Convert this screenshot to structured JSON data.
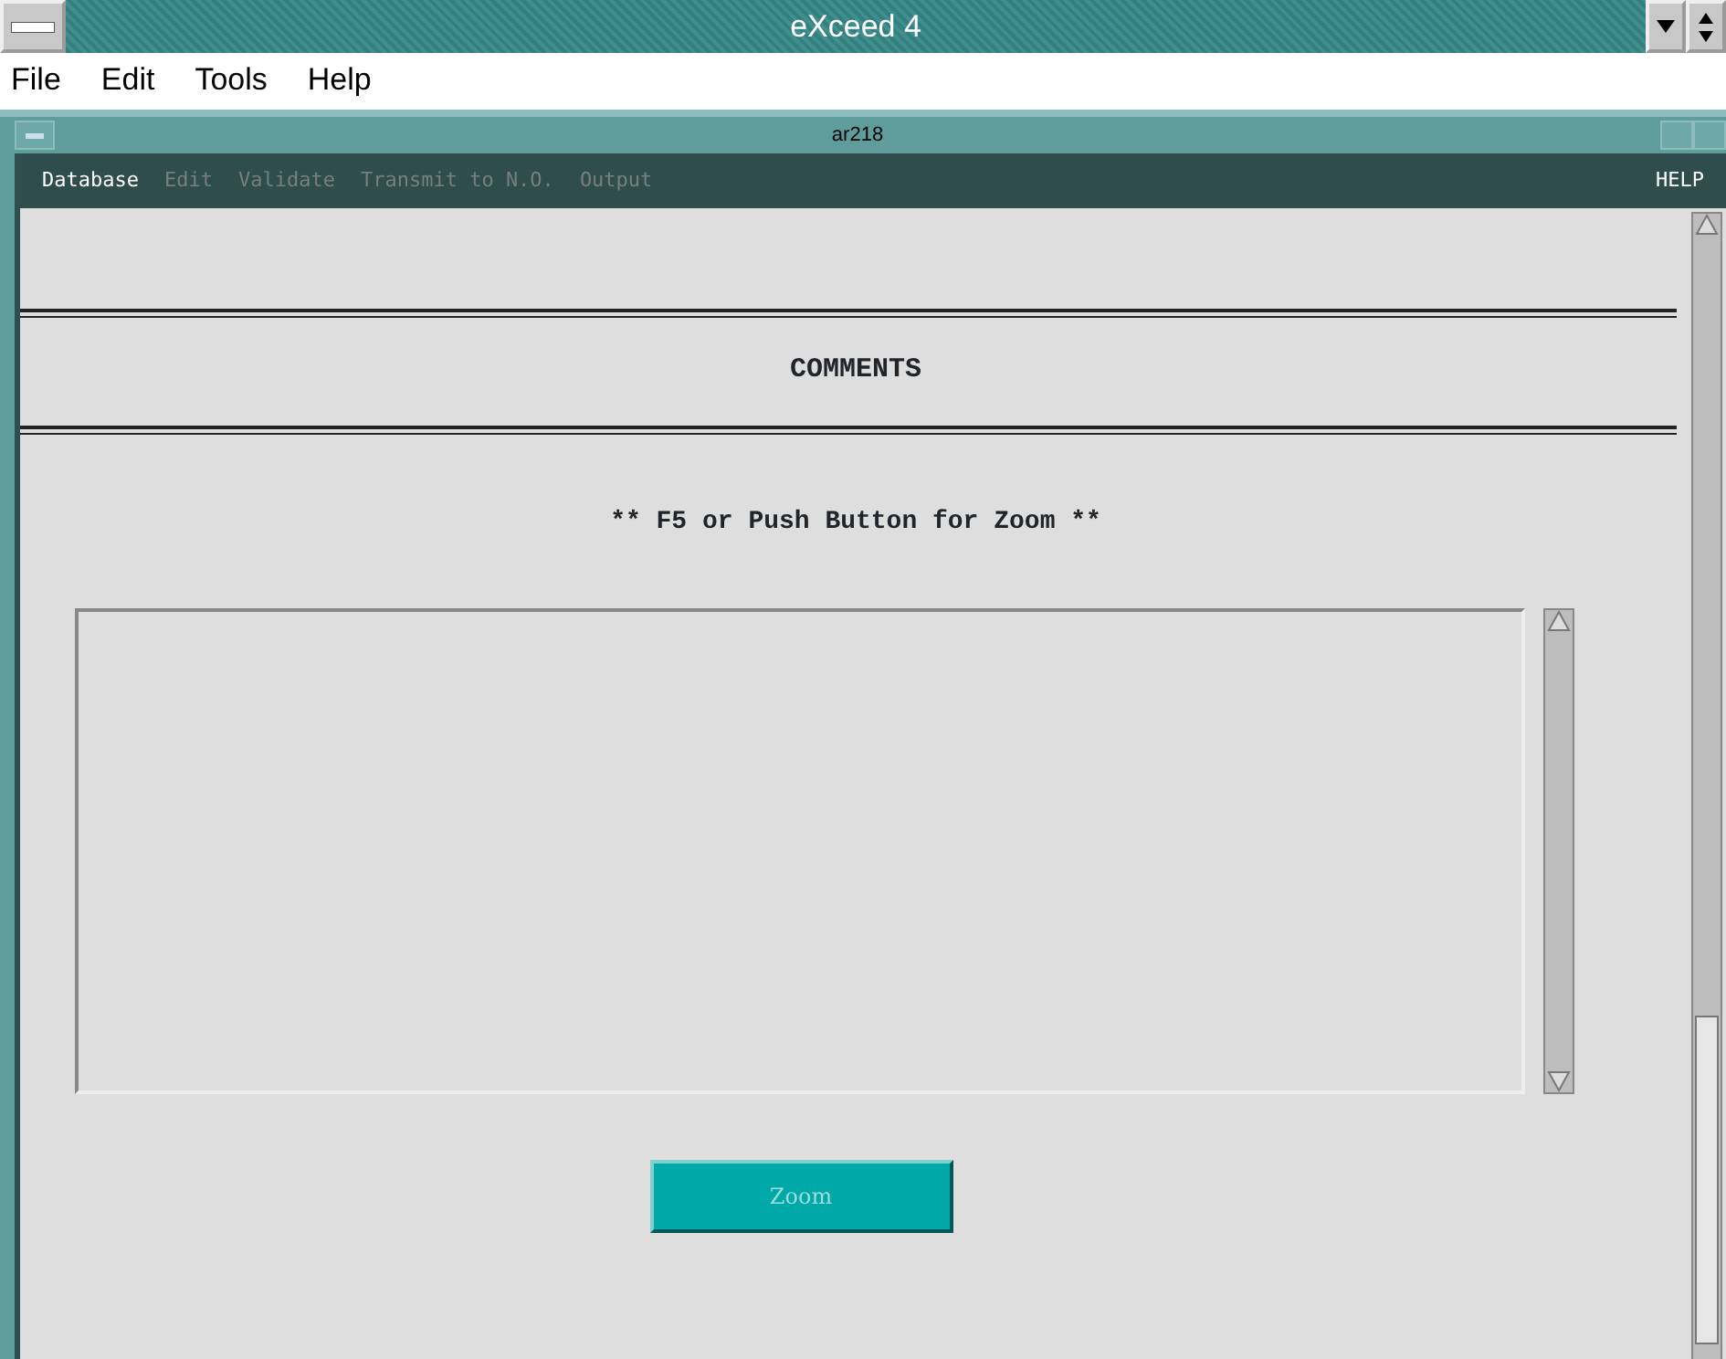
{
  "window": {
    "title": "eXceed 4"
  },
  "menu": [
    {
      "label": "File"
    },
    {
      "label": "Edit"
    },
    {
      "label": "Tools"
    },
    {
      "label": "Help"
    }
  ],
  "inner_window": {
    "title": "ar218",
    "menu": [
      {
        "label": "Database",
        "disabled": false
      },
      {
        "label": "Edit",
        "disabled": true
      },
      {
        "label": "Validate",
        "disabled": true
      },
      {
        "label": "Transmit to N.O.",
        "disabled": true
      },
      {
        "label": "Output",
        "disabled": true
      }
    ],
    "help": "HELP",
    "heading": "COMMENTS",
    "hint": "** F5 or Push Button for Zoom **",
    "zoom_button": {
      "label": "Zoom",
      "disabled": true
    }
  }
}
